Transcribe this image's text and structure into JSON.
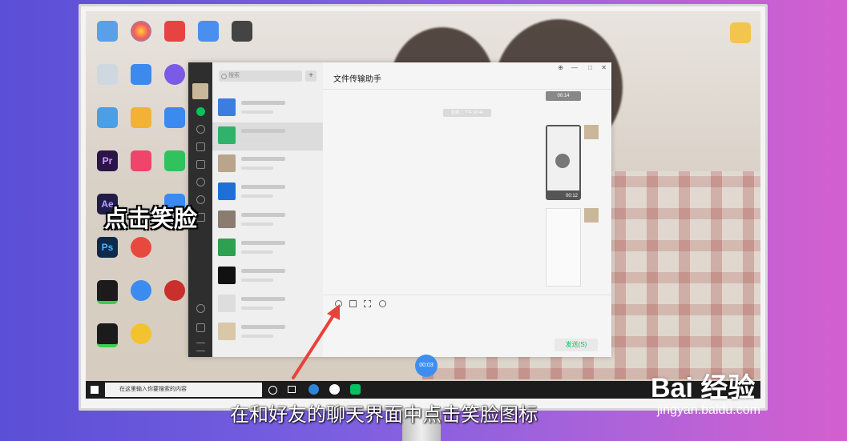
{
  "caption_main": "点击笑脸",
  "caption_sub": "在和好友的聊天界面中点击笑脸图标",
  "watermark": {
    "brand": "Bai  经验",
    "url": "jingyan.baidu.com"
  },
  "wechat": {
    "search_placeholder": "搜索",
    "plus_label": "+",
    "chat_title": "文件传输助手",
    "send_label": "发送(S)",
    "timestamp": "星期二 下午 02:44",
    "video_durations": [
      "00:14",
      "00:12"
    ],
    "window_buttons": {
      "pin": "⊕",
      "min": "—",
      "max": "□",
      "close": "✕"
    }
  },
  "recording_timer": "00:03",
  "taskbar": {
    "search_placeholder": "在这里输入你要搜索的内容"
  },
  "desktop": {
    "pr_label": "Pr",
    "ae_label": "Ae",
    "ps_label": "Ps"
  },
  "colors": {
    "accent": "#07c160",
    "arrow": "#e8423a",
    "timer": "#3d8ef0"
  }
}
